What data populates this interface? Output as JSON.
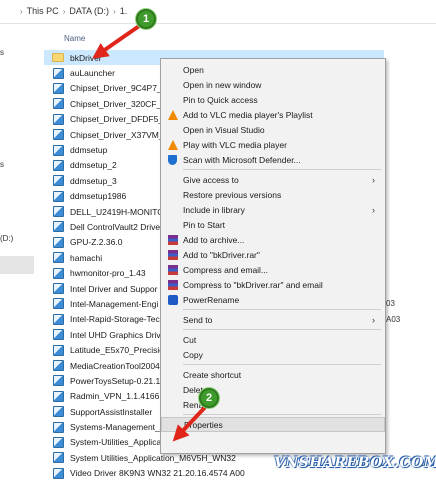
{
  "address_bar": {
    "crumbs": [
      "This PC",
      "DATA (D:)",
      "1."
    ]
  },
  "nav_pane": {
    "items": [
      "s",
      "",
      "",
      "",
      "s",
      "",
      "",
      "",
      "",
      "(D:)"
    ]
  },
  "file_list": {
    "column_header": "Name",
    "files": [
      {
        "name": "bkDriver",
        "type": "folder",
        "selected": true,
        "extra": ""
      },
      {
        "name": "auLauncher",
        "type": "exe",
        "selected": false,
        "extra": ""
      },
      {
        "name": "Chipset_Driver_9C4P7_W",
        "type": "exe",
        "selected": false,
        "extra": ""
      },
      {
        "name": "Chipset_Driver_320CF_W",
        "type": "exe",
        "selected": false,
        "extra": ""
      },
      {
        "name": "Chipset_Driver_DFDF5_W",
        "type": "exe",
        "selected": false,
        "extra": ""
      },
      {
        "name": "Chipset_Driver_X37VM_C",
        "type": "exe",
        "selected": false,
        "extra": ""
      },
      {
        "name": "ddmsetup",
        "type": "exe",
        "selected": false,
        "extra": ""
      },
      {
        "name": "ddmsetup_2",
        "type": "exe",
        "selected": false,
        "extra": ""
      },
      {
        "name": "ddmsetup_3",
        "type": "exe",
        "selected": false,
        "extra": ""
      },
      {
        "name": "ddmsetup1986",
        "type": "exe",
        "selected": false,
        "extra": ""
      },
      {
        "name": "DELL_U2419H-MONITOR",
        "type": "exe",
        "selected": false,
        "extra": ""
      },
      {
        "name": "Dell ControlVault2 Drive",
        "type": "exe",
        "selected": false,
        "extra": ""
      },
      {
        "name": "GPU-Z.2.36.0",
        "type": "exe",
        "selected": false,
        "extra": ""
      },
      {
        "name": "hamachi",
        "type": "exe",
        "selected": false,
        "extra": ""
      },
      {
        "name": "hwmonitor-pro_1.43",
        "type": "exe",
        "selected": false,
        "extra": ""
      },
      {
        "name": "Intel Driver and Suppor",
        "type": "exe",
        "selected": false,
        "extra": ""
      },
      {
        "name": "Intel-Management-Engi",
        "type": "exe",
        "selected": false,
        "extra": "03"
      },
      {
        "name": "Intel-Rapid-Storage-Tec",
        "type": "exe",
        "selected": false,
        "extra": "A03"
      },
      {
        "name": "Intel UHD Graphics Driv",
        "type": "exe",
        "selected": false,
        "extra": ""
      },
      {
        "name": "Latitude_E5x70_Precisio",
        "type": "exe",
        "selected": false,
        "extra": ""
      },
      {
        "name": "MediaCreationTool2004",
        "type": "exe",
        "selected": false,
        "extra": ""
      },
      {
        "name": "PowerToysSetup-0.21.1",
        "type": "exe",
        "selected": false,
        "extra": ""
      },
      {
        "name": "Radmin_VPN_1.1.4166.8",
        "type": "exe",
        "selected": false,
        "extra": ""
      },
      {
        "name": "SupportAssistInstaller",
        "type": "exe",
        "selected": false,
        "extra": ""
      },
      {
        "name": "Systems-Management_Ap",
        "type": "exe",
        "selected": false,
        "extra": ""
      },
      {
        "name": "System-Utilities_Applica",
        "type": "exe",
        "selected": false,
        "extra": ""
      },
      {
        "name": "System Utilities_Application_M6V5H_WN32",
        "type": "exe",
        "selected": false,
        "extra": ""
      },
      {
        "name": "Video Driver 8K9N3 WN32 21.20.16.4574 A00",
        "type": "exe",
        "selected": false,
        "extra": ""
      }
    ]
  },
  "context_menu": {
    "items": [
      {
        "label": "Open",
        "icon": "",
        "submenu": false,
        "highlight": false
      },
      {
        "label": "Open in new window",
        "icon": "",
        "submenu": false,
        "highlight": false
      },
      {
        "label": "Pin to Quick access",
        "icon": "",
        "submenu": false,
        "highlight": false
      },
      {
        "label": "Add to VLC media player's Playlist",
        "icon": "vlc-icon",
        "submenu": false,
        "highlight": false
      },
      {
        "label": "Open in Visual Studio",
        "icon": "",
        "submenu": false,
        "highlight": false
      },
      {
        "label": "Play with VLC media player",
        "icon": "vlc-icon",
        "submenu": false,
        "highlight": false
      },
      {
        "label": "Scan with Microsoft Defender...",
        "icon": "defender-icon",
        "submenu": false,
        "highlight": false
      },
      {
        "sep": true
      },
      {
        "label": "Give access to",
        "icon": "",
        "submenu": true,
        "highlight": false
      },
      {
        "label": "Restore previous versions",
        "icon": "",
        "submenu": false,
        "highlight": false
      },
      {
        "label": "Include in library",
        "icon": "",
        "submenu": true,
        "highlight": false
      },
      {
        "label": "Pin to Start",
        "icon": "",
        "submenu": false,
        "highlight": false
      },
      {
        "label": "Add to archive...",
        "icon": "winrar-icon",
        "submenu": false,
        "highlight": false
      },
      {
        "label": "Add to \"bkDriver.rar\"",
        "icon": "winrar-icon",
        "submenu": false,
        "highlight": false
      },
      {
        "label": "Compress and email...",
        "icon": "winrar-icon",
        "submenu": false,
        "highlight": false
      },
      {
        "label": "Compress to \"bkDriver.rar\" and email",
        "icon": "winrar-icon",
        "submenu": false,
        "highlight": false
      },
      {
        "label": "PowerRename",
        "icon": "powerrename-icon",
        "submenu": false,
        "highlight": false
      },
      {
        "sep": true
      },
      {
        "label": "Send to",
        "icon": "",
        "submenu": true,
        "highlight": false
      },
      {
        "sep": true
      },
      {
        "label": "Cut",
        "icon": "",
        "submenu": false,
        "highlight": false
      },
      {
        "label": "Copy",
        "icon": "",
        "submenu": false,
        "highlight": false
      },
      {
        "sep": true
      },
      {
        "label": "Create shortcut",
        "icon": "",
        "submenu": false,
        "highlight": false
      },
      {
        "label": "Delete",
        "icon": "",
        "submenu": false,
        "highlight": false
      },
      {
        "label": "Rename",
        "icon": "",
        "submenu": false,
        "highlight": false
      },
      {
        "sep": true
      },
      {
        "label": "Properties",
        "icon": "",
        "submenu": false,
        "highlight": true
      }
    ]
  },
  "annotations": {
    "step1": "1",
    "step2": "2",
    "arrow_color": "#e0261b",
    "badge_color": "#3f9b2c"
  },
  "watermark": "VNSHAREBOX.COM"
}
